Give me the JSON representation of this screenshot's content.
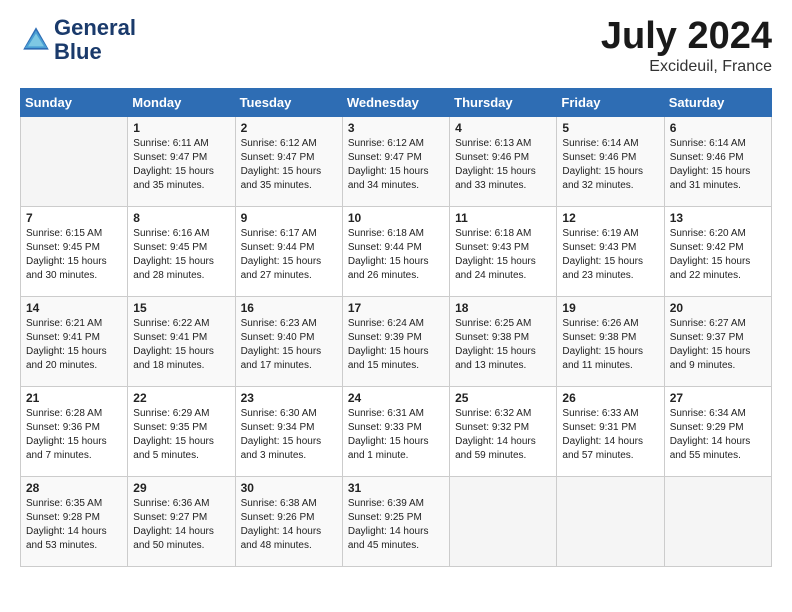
{
  "header": {
    "logo_line1": "General",
    "logo_line2": "Blue",
    "month": "July 2024",
    "location": "Excideuil, France"
  },
  "days_of_week": [
    "Sunday",
    "Monday",
    "Tuesday",
    "Wednesday",
    "Thursday",
    "Friday",
    "Saturday"
  ],
  "weeks": [
    [
      {
        "day": "",
        "info": ""
      },
      {
        "day": "1",
        "info": "Sunrise: 6:11 AM\nSunset: 9:47 PM\nDaylight: 15 hours\nand 35 minutes."
      },
      {
        "day": "2",
        "info": "Sunrise: 6:12 AM\nSunset: 9:47 PM\nDaylight: 15 hours\nand 35 minutes."
      },
      {
        "day": "3",
        "info": "Sunrise: 6:12 AM\nSunset: 9:47 PM\nDaylight: 15 hours\nand 34 minutes."
      },
      {
        "day": "4",
        "info": "Sunrise: 6:13 AM\nSunset: 9:46 PM\nDaylight: 15 hours\nand 33 minutes."
      },
      {
        "day": "5",
        "info": "Sunrise: 6:14 AM\nSunset: 9:46 PM\nDaylight: 15 hours\nand 32 minutes."
      },
      {
        "day": "6",
        "info": "Sunrise: 6:14 AM\nSunset: 9:46 PM\nDaylight: 15 hours\nand 31 minutes."
      }
    ],
    [
      {
        "day": "7",
        "info": "Sunrise: 6:15 AM\nSunset: 9:45 PM\nDaylight: 15 hours\nand 30 minutes."
      },
      {
        "day": "8",
        "info": "Sunrise: 6:16 AM\nSunset: 9:45 PM\nDaylight: 15 hours\nand 28 minutes."
      },
      {
        "day": "9",
        "info": "Sunrise: 6:17 AM\nSunset: 9:44 PM\nDaylight: 15 hours\nand 27 minutes."
      },
      {
        "day": "10",
        "info": "Sunrise: 6:18 AM\nSunset: 9:44 PM\nDaylight: 15 hours\nand 26 minutes."
      },
      {
        "day": "11",
        "info": "Sunrise: 6:18 AM\nSunset: 9:43 PM\nDaylight: 15 hours\nand 24 minutes."
      },
      {
        "day": "12",
        "info": "Sunrise: 6:19 AM\nSunset: 9:43 PM\nDaylight: 15 hours\nand 23 minutes."
      },
      {
        "day": "13",
        "info": "Sunrise: 6:20 AM\nSunset: 9:42 PM\nDaylight: 15 hours\nand 22 minutes."
      }
    ],
    [
      {
        "day": "14",
        "info": "Sunrise: 6:21 AM\nSunset: 9:41 PM\nDaylight: 15 hours\nand 20 minutes."
      },
      {
        "day": "15",
        "info": "Sunrise: 6:22 AM\nSunset: 9:41 PM\nDaylight: 15 hours\nand 18 minutes."
      },
      {
        "day": "16",
        "info": "Sunrise: 6:23 AM\nSunset: 9:40 PM\nDaylight: 15 hours\nand 17 minutes."
      },
      {
        "day": "17",
        "info": "Sunrise: 6:24 AM\nSunset: 9:39 PM\nDaylight: 15 hours\nand 15 minutes."
      },
      {
        "day": "18",
        "info": "Sunrise: 6:25 AM\nSunset: 9:38 PM\nDaylight: 15 hours\nand 13 minutes."
      },
      {
        "day": "19",
        "info": "Sunrise: 6:26 AM\nSunset: 9:38 PM\nDaylight: 15 hours\nand 11 minutes."
      },
      {
        "day": "20",
        "info": "Sunrise: 6:27 AM\nSunset: 9:37 PM\nDaylight: 15 hours\nand 9 minutes."
      }
    ],
    [
      {
        "day": "21",
        "info": "Sunrise: 6:28 AM\nSunset: 9:36 PM\nDaylight: 15 hours\nand 7 minutes."
      },
      {
        "day": "22",
        "info": "Sunrise: 6:29 AM\nSunset: 9:35 PM\nDaylight: 15 hours\nand 5 minutes."
      },
      {
        "day": "23",
        "info": "Sunrise: 6:30 AM\nSunset: 9:34 PM\nDaylight: 15 hours\nand 3 minutes."
      },
      {
        "day": "24",
        "info": "Sunrise: 6:31 AM\nSunset: 9:33 PM\nDaylight: 15 hours\nand 1 minute."
      },
      {
        "day": "25",
        "info": "Sunrise: 6:32 AM\nSunset: 9:32 PM\nDaylight: 14 hours\nand 59 minutes."
      },
      {
        "day": "26",
        "info": "Sunrise: 6:33 AM\nSunset: 9:31 PM\nDaylight: 14 hours\nand 57 minutes."
      },
      {
        "day": "27",
        "info": "Sunrise: 6:34 AM\nSunset: 9:29 PM\nDaylight: 14 hours\nand 55 minutes."
      }
    ],
    [
      {
        "day": "28",
        "info": "Sunrise: 6:35 AM\nSunset: 9:28 PM\nDaylight: 14 hours\nand 53 minutes."
      },
      {
        "day": "29",
        "info": "Sunrise: 6:36 AM\nSunset: 9:27 PM\nDaylight: 14 hours\nand 50 minutes."
      },
      {
        "day": "30",
        "info": "Sunrise: 6:38 AM\nSunset: 9:26 PM\nDaylight: 14 hours\nand 48 minutes."
      },
      {
        "day": "31",
        "info": "Sunrise: 6:39 AM\nSunset: 9:25 PM\nDaylight: 14 hours\nand 45 minutes."
      },
      {
        "day": "",
        "info": ""
      },
      {
        "day": "",
        "info": ""
      },
      {
        "day": "",
        "info": ""
      }
    ]
  ]
}
